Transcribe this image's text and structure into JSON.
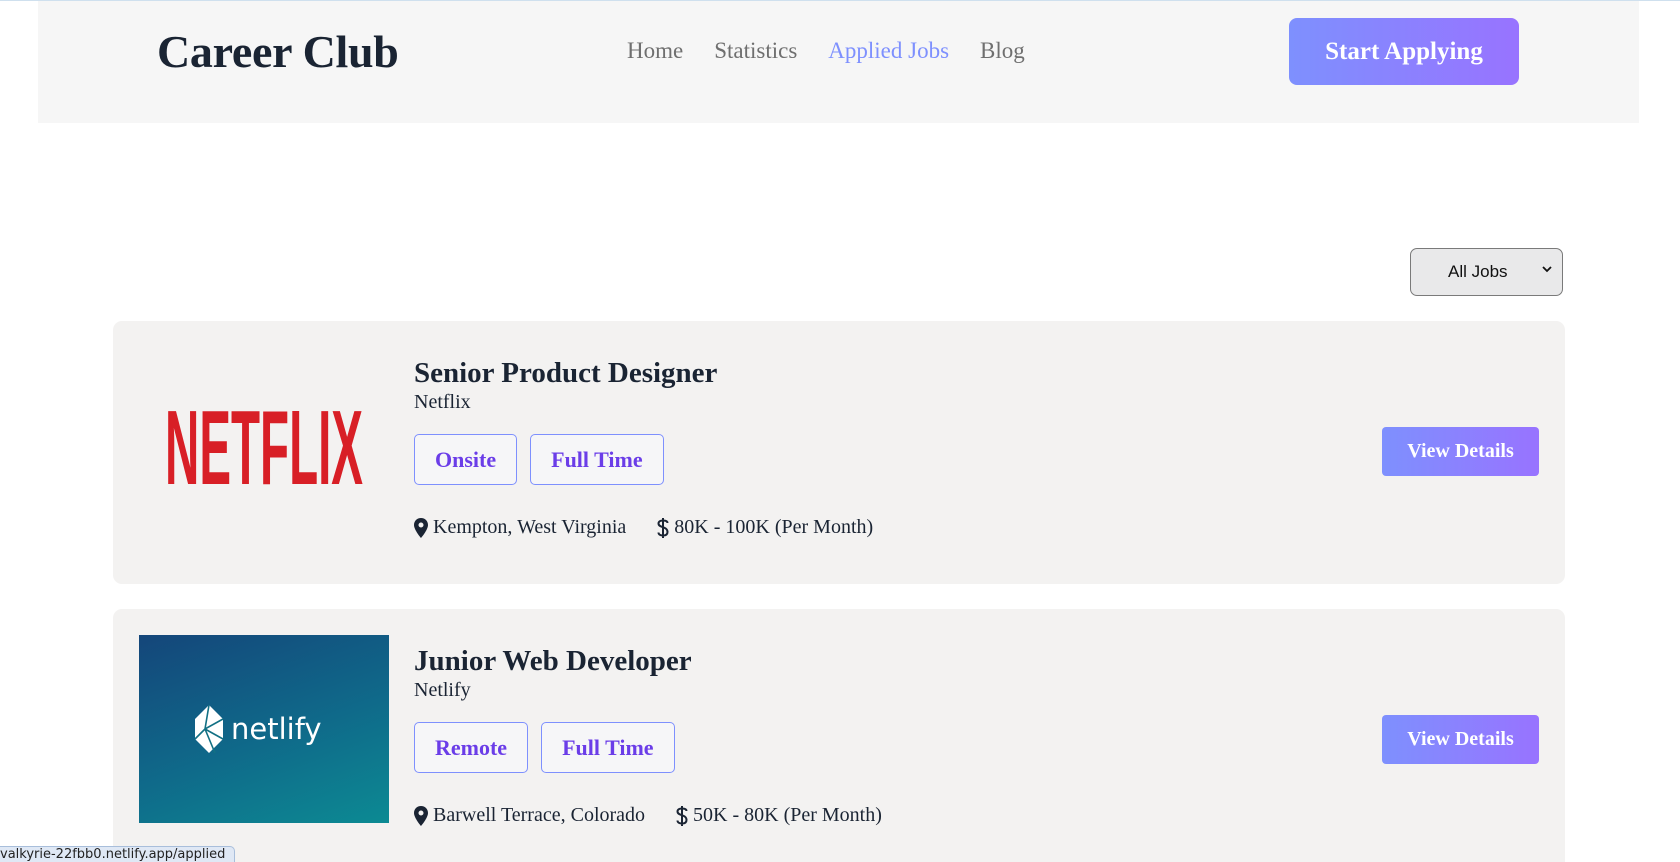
{
  "header": {
    "brand": "Career Club",
    "nav": [
      {
        "label": "Home",
        "active": false
      },
      {
        "label": "Statistics",
        "active": false
      },
      {
        "label": "Applied Jobs",
        "active": true
      },
      {
        "label": "Blog",
        "active": false
      }
    ],
    "cta_label": "Start Applying"
  },
  "filter": {
    "selected": "All Jobs"
  },
  "jobs": [
    {
      "title": "Senior Product Designer",
      "company": "Netflix",
      "logo_text": "NETFLIX",
      "tags": [
        "Onsite",
        "Full Time"
      ],
      "location": "Kempton, West Virginia",
      "salary": "80K - 100K (Per Month)",
      "details_label": "View Details"
    },
    {
      "title": "Junior Web Developer",
      "company": "Netlify",
      "logo_text": "netlify",
      "tags": [
        "Remote",
        "Full Time"
      ],
      "location": "Barwell Terrace, Colorado",
      "salary": "50K - 80K (Per Month)",
      "details_label": "View Details"
    }
  ],
  "status_url": "valkyrie-22fbb0.netlify.app/applied",
  "colors": {
    "accent": "#7e90fe",
    "accent_end": "#9873ff",
    "tag_text": "#6b3de8",
    "netflix_red": "#d81f26"
  }
}
